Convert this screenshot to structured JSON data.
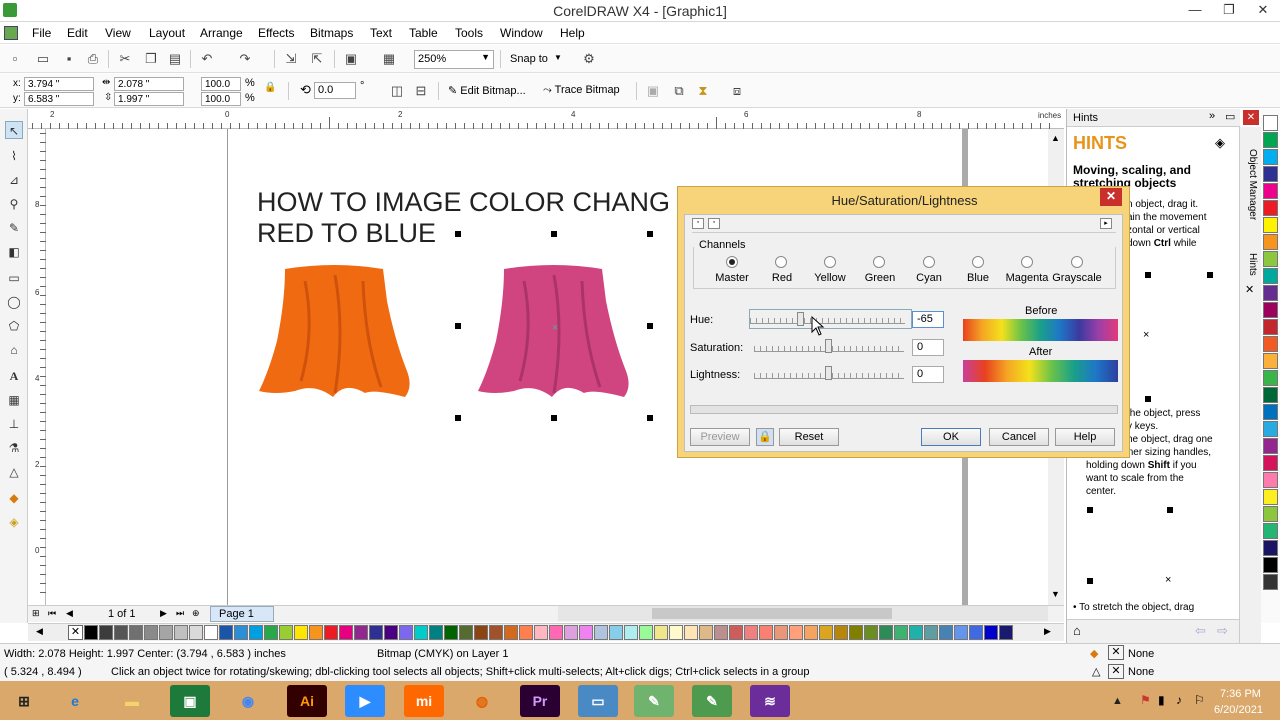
{
  "window": {
    "title": "CorelDRAW X4 - [Graphic1]"
  },
  "menu": [
    "File",
    "Edit",
    "View",
    "Layout",
    "Arrange",
    "Effects",
    "Bitmaps",
    "Text",
    "Table",
    "Tools",
    "Window",
    "Help"
  ],
  "toolbar": {
    "zoom": "250%",
    "snap_to": "Snap to"
  },
  "propbar": {
    "x_label": "x:",
    "x_value": "3.794 \"",
    "y_label": "y:",
    "y_value": "6.583 \"",
    "w_value": "2.078 \"",
    "h_value": "1.997 \"",
    "scale_x": "100.0",
    "scale_y": "100.0",
    "pct": "%",
    "angle": "0.0",
    "deg": "°",
    "edit_bitmap": "Edit Bitmap...",
    "trace_bitmap": "Trace Bitmap"
  },
  "ruler": {
    "units": "inches",
    "h_ticks": [
      "2",
      "0",
      "2",
      "4",
      "6",
      "8",
      "10"
    ],
    "v_ticks": [
      "8",
      "6",
      "4",
      "2",
      "0"
    ]
  },
  "canvas": {
    "heading_line1": "HOW TO IMAGE COLOR CHANG",
    "heading_line2": "RED TO BLUE"
  },
  "pagebar": {
    "page_count": "1 of 1",
    "page_tab": "Page 1"
  },
  "dialog": {
    "title": "Hue/Saturation/Lightness",
    "channels_label": "Channels",
    "channels": [
      "Master",
      "Red",
      "Yellow",
      "Green",
      "Cyan",
      "Blue",
      "Magenta",
      "Grayscale"
    ],
    "selected_channel": "Master",
    "hue_label": "Hue:",
    "hue_value": "-65",
    "saturation_label": "Saturation:",
    "saturation_value": "0",
    "lightness_label": "Lightness:",
    "lightness_value": "0",
    "before_label": "Before",
    "after_label": "After",
    "preview": "Preview",
    "reset": "Reset",
    "ok": "OK",
    "cancel": "Cancel",
    "help": "Help"
  },
  "docker": {
    "tab_title": "Hints",
    "header": "HINTS",
    "subtitle": "Moving, scaling, and stretching objects",
    "text_1": "n object, drag it.",
    "text_2": "ain the movement",
    "text_3": "zontal or vertical",
    "text_4_a": "down ",
    "text_4_b": "Ctrl",
    "text_4_c": " while",
    "text_5": "the object, press",
    "text_6": "v keys.",
    "text_7": "he object, drag one",
    "text_8": "of the corner sizing handles,",
    "text_9_a": "holding down ",
    "text_9_b": "Shift",
    "text_9_c": " if you",
    "text_10": "want to scale from the",
    "text_11": "center.",
    "text_12": "• To stretch the object, drag",
    "side_tabs": [
      "Object Manager",
      "Hints"
    ]
  },
  "status": {
    "dims": "Width: 2.078  Height: 1.997  Center: (3.794 , 6.583 )  inches",
    "object": "Bitmap (CMYK) on Layer 1",
    "coords": "( 5.324 , 8.494 )",
    "hint": "Click an object twice for rotating/skewing; dbl-clicking tool selects all objects; Shift+click multi-selects; Alt+click digs; Ctrl+click selects in a group",
    "fill": "None",
    "outline": "None"
  },
  "taskbar": {
    "time": "7:36 PM",
    "date": "6/20/2021"
  },
  "colors": {
    "orange_cloth": "#f06a12",
    "pink_cloth": "#d0457f",
    "dialog_frame": "#f7d47a",
    "taskbar": "#d9a86a",
    "hints_header": "#e8941a"
  },
  "palette_colors": [
    "#000000",
    "#3c3c3c",
    "#555555",
    "#707070",
    "#8a8a8a",
    "#a5a5a5",
    "#c0c0c0",
    "#dadada",
    "#ffffff",
    "#1b55a7",
    "#2a8fd6",
    "#00a0e0",
    "#27a84a",
    "#9acd32",
    "#ffe600",
    "#f7941d",
    "#ed1c24",
    "#e4007f",
    "#92278f",
    "#2e3192",
    "#4b0082",
    "#7b68ee",
    "#00cccc",
    "#008080",
    "#006400",
    "#556b2f",
    "#8b4513",
    "#a0522d",
    "#d2691e",
    "#ff7f50",
    "#ffb6c1",
    "#ff69b4",
    "#dda0dd",
    "#ee82ee",
    "#b0c4de",
    "#87ceeb",
    "#afeeee",
    "#98fb98",
    "#f0e68c",
    "#fffacd",
    "#ffe4b5",
    "#deb887",
    "#bc8f8f",
    "#cd5c5c",
    "#f08080",
    "#fa8072",
    "#e9967a",
    "#ffa07a",
    "#f4a460",
    "#daa520",
    "#b8860b",
    "#808000",
    "#6b8e23",
    "#2e8b57",
    "#3cb371",
    "#20b2aa",
    "#5f9ea0",
    "#4682b4",
    "#6495ed",
    "#4169e1",
    "#0000cd",
    "#191970"
  ],
  "vpalette_colors": [
    "#ffffff",
    "#00a651",
    "#00aeef",
    "#2e3192",
    "#ec008c",
    "#ed1c24",
    "#fff200",
    "#f7941d",
    "#8dc63f",
    "#00a99d",
    "#662d91",
    "#9e005d",
    "#c1272d",
    "#f15a24",
    "#fbb03b",
    "#39b54a",
    "#006837",
    "#0071bc",
    "#29abe2",
    "#93278f",
    "#d4145a",
    "#ff7bac",
    "#fcee21",
    "#8cc63f",
    "#22b573",
    "#1b1464",
    "#000000",
    "#333333"
  ]
}
